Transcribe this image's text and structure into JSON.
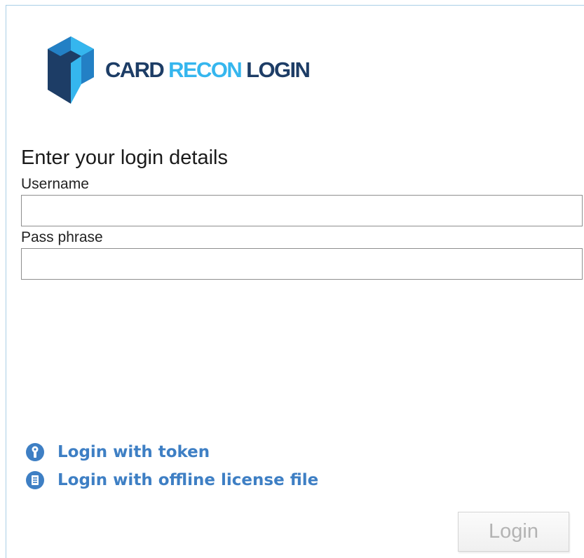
{
  "brand": {
    "word1": "CARD",
    "word2": "RECON",
    "word3": "LOGIN",
    "colors": {
      "dark": "#1d3d66",
      "light": "#35b6ee",
      "mid": "#2380c5"
    }
  },
  "form": {
    "heading": "Enter your login details",
    "username_label": "Username",
    "username_value": "",
    "passphrase_label": "Pass phrase",
    "passphrase_value": ""
  },
  "links": {
    "token": {
      "label": "Login with token",
      "icon": "key-icon"
    },
    "offline": {
      "label": "Login with offline license file",
      "icon": "document-icon"
    },
    "color": "#3e7fc4"
  },
  "login_button": {
    "label": "Login",
    "state": "disabled"
  }
}
